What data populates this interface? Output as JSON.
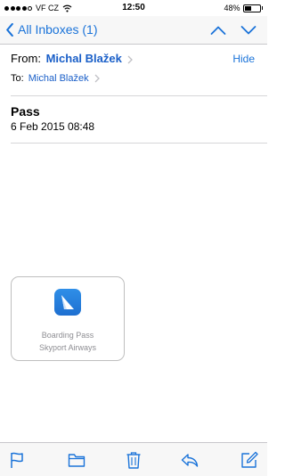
{
  "status_bar": {
    "carrier": "VF CZ",
    "time": "12:50",
    "battery_percent": "48%",
    "battery_level": 0.48,
    "signal_bars_filled": 4
  },
  "nav": {
    "back_label": "All Inboxes (1)",
    "icons": [
      "chevron-left-icon",
      "arrow-up-icon",
      "arrow-down-icon"
    ]
  },
  "header": {
    "from_label": "From:",
    "from_name": "Michal Blažek",
    "hide_label": "Hide",
    "to_label": "To:",
    "to_name": "Michal Blažek"
  },
  "message": {
    "subject": "Pass",
    "date": "6 Feb 2015 08:48"
  },
  "attachment": {
    "title": "Boarding Pass",
    "subtitle": "Skyport Airways",
    "icon": "airplane-tail-icon"
  },
  "toolbar": {
    "icons": [
      "flag-icon",
      "folder-icon",
      "trash-icon",
      "reply-icon",
      "compose-icon"
    ]
  },
  "colors": {
    "accent": "#1a73d9",
    "link": "#1a5fc8",
    "muted": "#8e8e93"
  }
}
